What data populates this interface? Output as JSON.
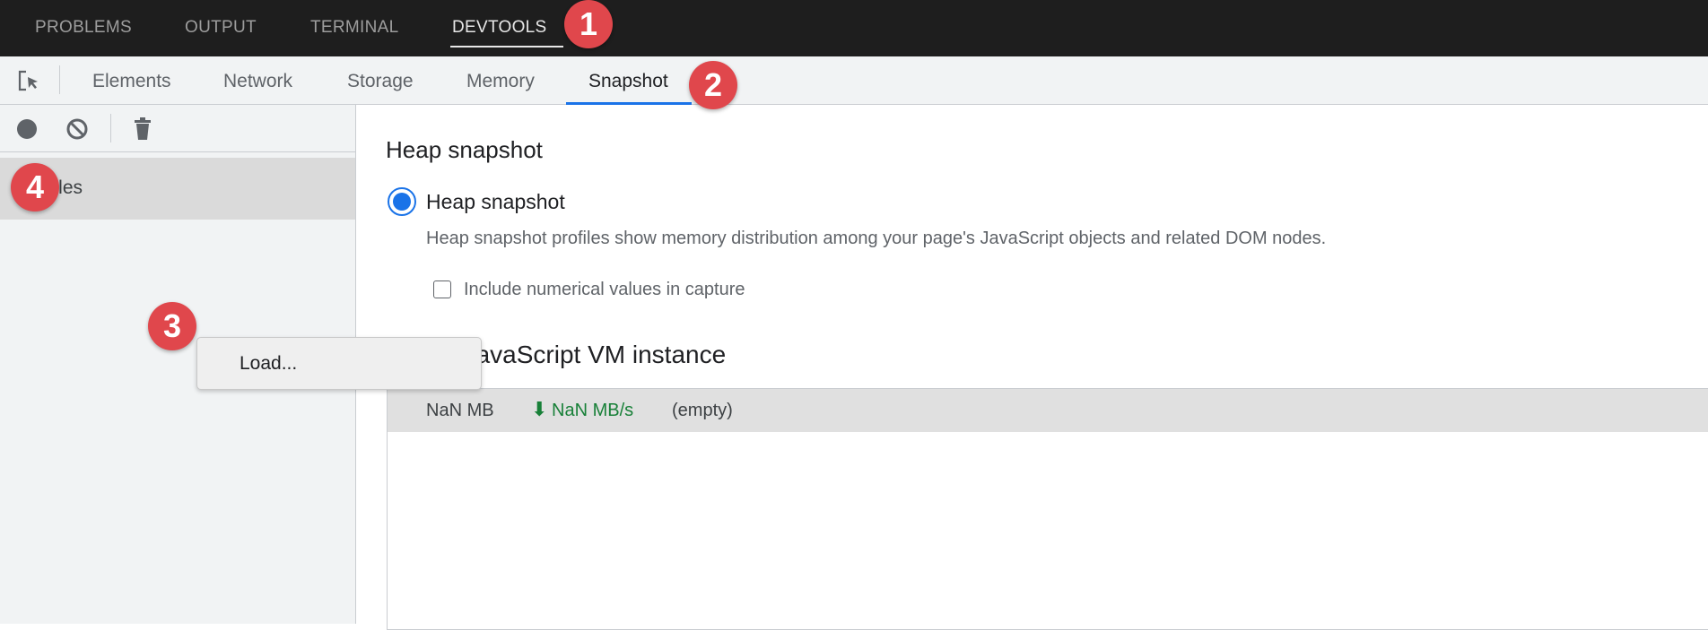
{
  "panel_tabs": [
    {
      "label": "PROBLEMS"
    },
    {
      "label": "OUTPUT"
    },
    {
      "label": "TERMINAL"
    },
    {
      "label": "DEVTOOLS",
      "active": true
    }
  ],
  "devtools_tabs": [
    {
      "label": "Elements"
    },
    {
      "label": "Network"
    },
    {
      "label": "Storage"
    },
    {
      "label": "Memory"
    },
    {
      "label": "Snapshot",
      "active": true
    }
  ],
  "sidebar": {
    "profiles_label": "Profiles"
  },
  "context_menu": {
    "items": [
      {
        "label": "Load..."
      }
    ]
  },
  "main": {
    "section_title": "Heap snapshot",
    "radio_label": "Heap snapshot",
    "radio_selected": true,
    "description": "Heap snapshot profiles show memory distribution among your page's JavaScript objects and related DOM nodes.",
    "checkbox_label": "Include numerical values in capture",
    "checkbox_checked": false,
    "vm_title": "Select JavaScript VM instance",
    "vm_row": {
      "size": "NaN MB",
      "rate": "NaN MB/s",
      "name": "(empty)"
    }
  },
  "badges": [
    "1",
    "2",
    "3",
    "4"
  ],
  "colors": {
    "accent": "#1a73e8",
    "badge": "#e0474c",
    "rate": "#188038"
  }
}
